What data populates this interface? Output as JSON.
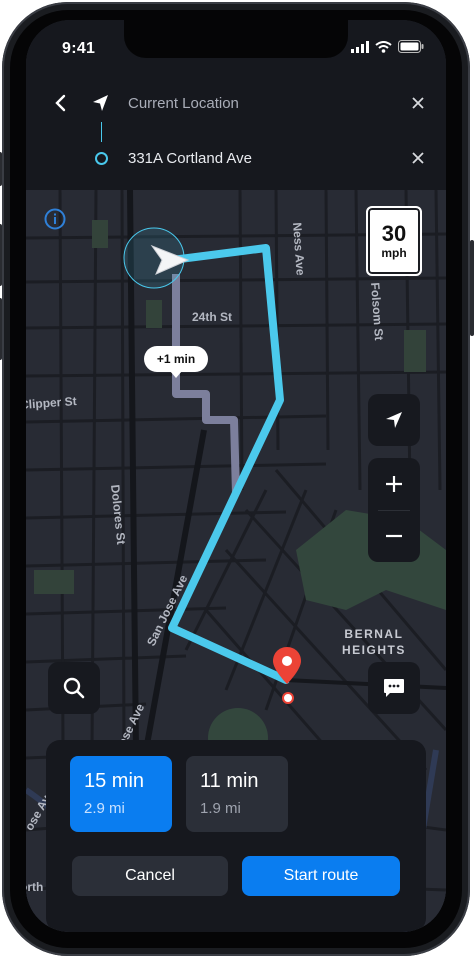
{
  "status": {
    "time": "9:41"
  },
  "route": {
    "origin": "Current Location",
    "destination": "331A Cortland Ave"
  },
  "map": {
    "streets": [
      {
        "id": "ness-ave",
        "label": "Ness Ave"
      },
      {
        "id": "24th-st",
        "label": "24th St"
      },
      {
        "id": "folsom-st",
        "label": "Folsom St"
      },
      {
        "id": "clipper-st",
        "label": "Clipper St"
      },
      {
        "id": "dolores-st",
        "label": "Dolores St"
      },
      {
        "id": "san-jose-ave",
        "label": "San Jose Ave"
      },
      {
        "id": "jose-ave",
        "label": "Jose Ave"
      },
      {
        "id": "ose-ave",
        "label": "ose Ave"
      },
      {
        "id": "orth",
        "label": "orth"
      }
    ],
    "neighborhood": [
      "BERNAL",
      "HEIGHTS"
    ],
    "speed_limit": {
      "value": "30",
      "unit": "mph"
    },
    "alt_route_badge": "+1 min",
    "colors": {
      "primary_route": "#49c8ec",
      "alt_route": "#7c7f9c",
      "pin": "#ec4336",
      "park": "#3c5649"
    }
  },
  "options": [
    {
      "time": "15 min",
      "distance": "2.9 mi",
      "selected": true
    },
    {
      "time": "11 min",
      "distance": "1.9 mi",
      "selected": false
    }
  ],
  "actions": {
    "cancel": "Cancel",
    "start": "Start route"
  },
  "icons": [
    "back-icon",
    "navigation-arrow-icon",
    "close-icon",
    "info-icon",
    "locate-icon",
    "zoom-in-icon",
    "zoom-out-icon",
    "search-icon",
    "message-icon",
    "pin-icon"
  ],
  "accent": "#0a7df0"
}
